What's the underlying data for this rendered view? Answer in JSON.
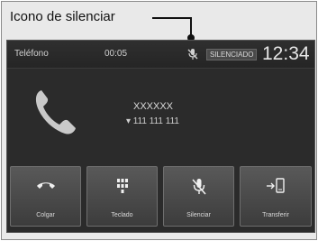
{
  "callout": {
    "label": "Icono de silenciar"
  },
  "status_bar": {
    "left_text": "Teléfono",
    "middle_text": "00:05",
    "tag_text": "SILENCIADO",
    "clock": "12:34"
  },
  "call": {
    "caller_name": "XXXXXX",
    "caller_number": "▾ 111 111 111"
  },
  "buttons": [
    {
      "label": "Colgar",
      "icon": "hang-up-icon"
    },
    {
      "label": "Teclado",
      "icon": "keypad-icon"
    },
    {
      "label": "Silenciar",
      "icon": "mute-microphone-icon"
    },
    {
      "label": "Transferir",
      "icon": "transfer-phone-icon"
    }
  ],
  "colors": {
    "screen_background": "#2b2b2b",
    "button_top": "#595959",
    "button_bottom": "#3c3c3c",
    "text_light": "#e6e6e6"
  }
}
